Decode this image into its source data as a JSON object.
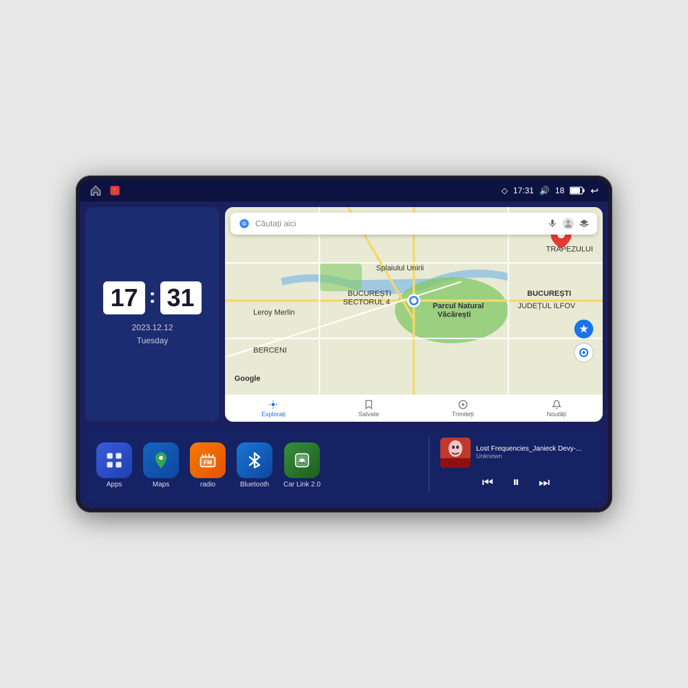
{
  "device": {
    "status_bar": {
      "location_icon": "◇",
      "time": "17:31",
      "volume_icon": "🔊",
      "battery_level": "18",
      "battery_icon": "🔋",
      "back_icon": "↩"
    },
    "nav_icons": [
      {
        "name": "home",
        "symbol": "⌂"
      },
      {
        "name": "maps-pin",
        "symbol": "📍"
      }
    ],
    "clock": {
      "hour": "17",
      "minute": "31",
      "date": "2023.12.12",
      "day": "Tuesday"
    },
    "map": {
      "search_placeholder": "Căutați aici",
      "bottom_nav": [
        {
          "label": "Explorați",
          "active": true
        },
        {
          "label": "Salvate",
          "active": false
        },
        {
          "label": "Trimiteți",
          "active": false
        },
        {
          "label": "Noutăți",
          "active": false
        }
      ]
    },
    "apps": [
      {
        "id": "apps",
        "label": "Apps",
        "color": "#3b5bdb",
        "bg": "#2d4bc4"
      },
      {
        "id": "maps",
        "label": "Maps",
        "color": "#4caf50",
        "bg": "#1565c0"
      },
      {
        "id": "radio",
        "label": "radio",
        "color": "#ff9800",
        "bg": "#e65c00"
      },
      {
        "id": "bluetooth",
        "label": "Bluetooth",
        "color": "#64b5f6",
        "bg": "#1976d2"
      },
      {
        "id": "carlink",
        "label": "Car Link 2.0",
        "color": "#4caf50",
        "bg": "#1b5e20"
      }
    ],
    "music": {
      "title": "Lost Frequencies_Janieck Devy-...",
      "artist": "Unknown",
      "controls": {
        "prev": "⏮",
        "play": "⏸",
        "next": "⏭"
      }
    }
  }
}
